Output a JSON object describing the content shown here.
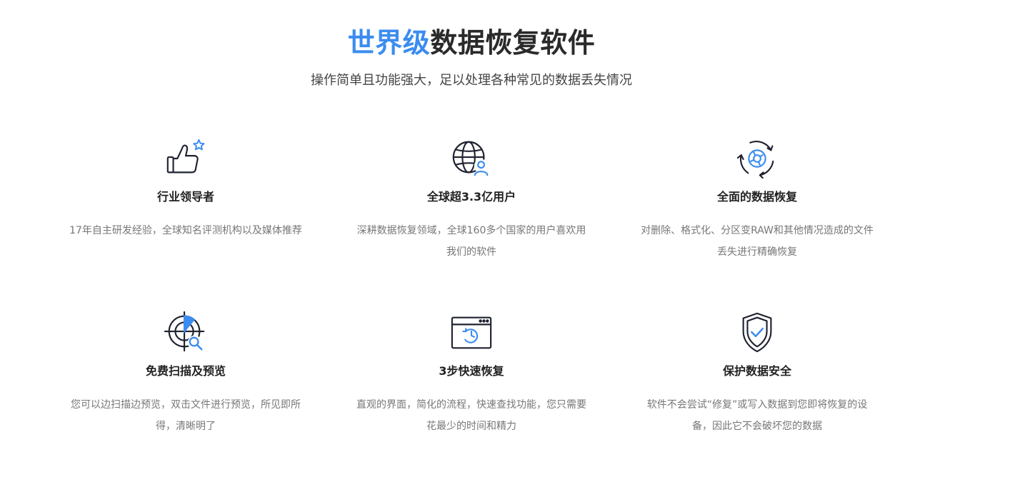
{
  "hero": {
    "title_accent": "世界级",
    "title_rest": "数据恢复软件",
    "subtitle": "操作简单且功能强大，足以处理各种常见的数据丢失情况"
  },
  "colors": {
    "accent": "#3b8cf0",
    "icon_stroke": "#1f2230"
  },
  "features": [
    {
      "icon": "thumbs-up-star-icon",
      "title": "行业领导者",
      "desc": "17年自主研发经验，全球知名评测机构以及媒体推荐"
    },
    {
      "icon": "globe-user-icon",
      "title": "全球超3.3亿用户",
      "desc": "深耕数据恢复领域，全球160多个国家的用户喜欢用我们的软件"
    },
    {
      "icon": "recovery-cycle-icon",
      "title": "全面的数据恢复",
      "desc": "对删除、格式化、分区变RAW和其他情况造成的文件丢失进行精确恢复"
    },
    {
      "icon": "radar-scan-icon",
      "title": "免费扫描及预览",
      "desc": "您可以边扫描边预览，双击文件进行预览，所见即所得，清晰明了"
    },
    {
      "icon": "browser-history-icon",
      "title": "3步快速恢复",
      "desc": "直观的界面，简化的流程，快速查找功能，您只需要花最少的时间和精力"
    },
    {
      "icon": "shield-check-icon",
      "title": "保护数据安全",
      "desc": "软件不会尝试“修复”或写入数据到您即将恢复的设备，因此它不会破坏您的数据"
    }
  ]
}
